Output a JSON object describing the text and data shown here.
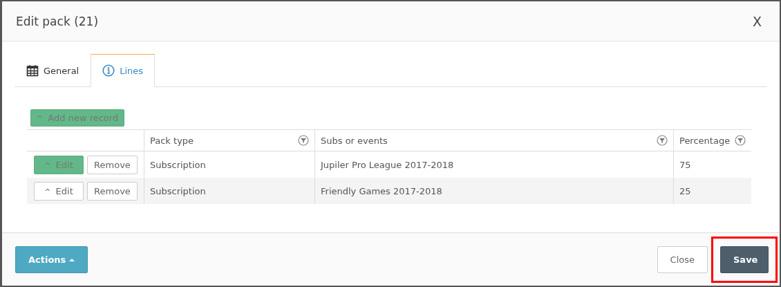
{
  "window": {
    "title": "Edit pack (21)",
    "close": "X"
  },
  "tabs": [
    {
      "label": "General",
      "kind": "calendar",
      "selected": false
    },
    {
      "label": "Lines",
      "kind": "info",
      "selected": true
    }
  ],
  "add_button": {
    "label": "Add new record",
    "caret": "^"
  },
  "table": {
    "columns": [
      "Pack type",
      "Subs or events",
      "Percentage"
    ],
    "rows": [
      {
        "edit": "Edit",
        "remove": "Remove",
        "edit_active": true,
        "cells": [
          "Subscription",
          "Jupiler Pro League 2017-2018",
          "75"
        ]
      },
      {
        "edit": "Edit",
        "remove": "Remove",
        "edit_active": false,
        "cells": [
          "Subscription",
          "Friendly Games 2017-2018",
          "25"
        ]
      }
    ]
  },
  "footer": {
    "actions": "Actions",
    "close": "Close",
    "save": "Save",
    "save_highlighted": true
  }
}
